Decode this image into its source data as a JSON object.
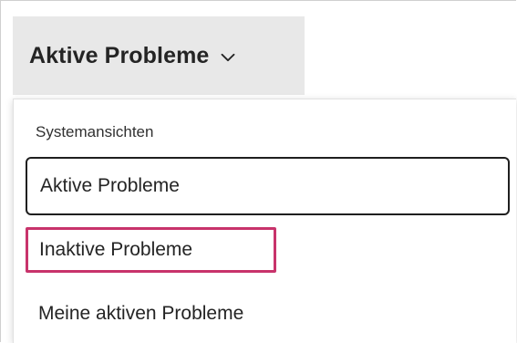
{
  "view_selector": {
    "title": "Aktive Probleme",
    "icon": "chevron-down-icon"
  },
  "dropdown": {
    "section_header": "Systemansichten",
    "options": [
      {
        "label": "Aktive Probleme",
        "state": "selected"
      },
      {
        "label": "Inaktive Probleme",
        "state": "highlighted"
      },
      {
        "label": "Meine aktiven Probleme",
        "state": "default"
      }
    ]
  },
  "colors": {
    "selector_bg": "#e8e8e8",
    "highlight_border": "#c8336b",
    "selected_border": "#1f1f1f",
    "text": "#242424"
  }
}
